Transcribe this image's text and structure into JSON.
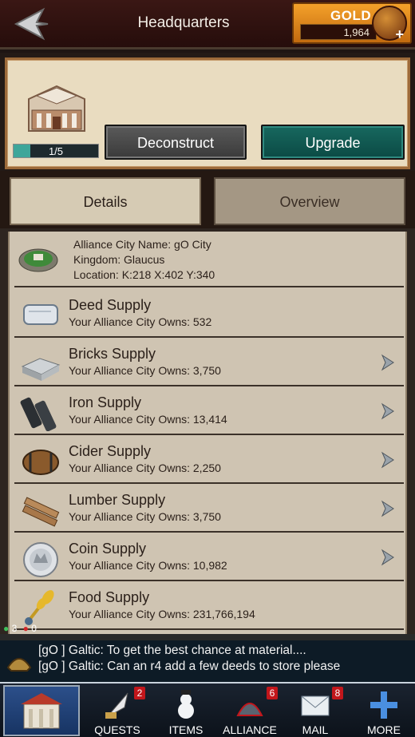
{
  "header": {
    "title": "Headquarters"
  },
  "gold": {
    "label": "GOLD",
    "amount": "1,964"
  },
  "building": {
    "level_text": "1/5",
    "level_progress": 0.2
  },
  "actions": {
    "deconstruct": "Deconstruct",
    "upgrade": "Upgrade"
  },
  "tabs": {
    "details": "Details",
    "overview": "Overview"
  },
  "city": {
    "name": "Alliance City Name: gO City",
    "kingdom": "Kingdom: Glaucus",
    "location": "Location: K:218 X:402 Y:340"
  },
  "supplies": [
    {
      "title": "Deed Supply",
      "owns": "Your Alliance City Owns: 532",
      "icon": "deed-icon",
      "has_arrow": false
    },
    {
      "title": "Bricks Supply",
      "owns": "Your Alliance City Owns: 3,750",
      "icon": "bricks-icon",
      "has_arrow": true
    },
    {
      "title": "Iron Supply",
      "owns": "Your Alliance City Owns: 13,414",
      "icon": "iron-icon",
      "has_arrow": true
    },
    {
      "title": "Cider Supply",
      "owns": "Your Alliance City Owns: 2,250",
      "icon": "cider-barrel-icon",
      "has_arrow": true
    },
    {
      "title": "Lumber Supply",
      "owns": "Your Alliance City Owns: 3,750",
      "icon": "lumber-icon",
      "has_arrow": true
    },
    {
      "title": "Coin Supply",
      "owns": "Your Alliance City Owns: 10,982",
      "icon": "coin-icon",
      "has_arrow": true
    },
    {
      "title": "Food Supply",
      "owns": "Your Alliance City Owns: 231,766,194",
      "icon": "wheat-icon",
      "has_arrow": false
    }
  ],
  "chat": {
    "online_green": "3",
    "online_red": "0",
    "lines": [
      "[gO ] Galtic: To get the best chance at material....",
      "[gO ] Galtic: Can an r4 add a few deeds to store please"
    ]
  },
  "nav": [
    {
      "label": "QUESTS",
      "badge": "2",
      "icon": "quest-quill-icon"
    },
    {
      "label": "ITEMS",
      "badge": "",
      "icon": "snowman-icon"
    },
    {
      "label": "ALLIANCE",
      "badge": "6",
      "icon": "alliance-dome-icon"
    },
    {
      "label": "MAIL",
      "badge": "8",
      "icon": "mail-icon"
    },
    {
      "label": "MORE",
      "badge": "",
      "icon": "plus-icon"
    }
  ],
  "colors": {
    "upgrade": "#0b4a44",
    "gold": "#f4a12a",
    "panel": "#e9dcc0",
    "list": "#cfc4b2"
  }
}
